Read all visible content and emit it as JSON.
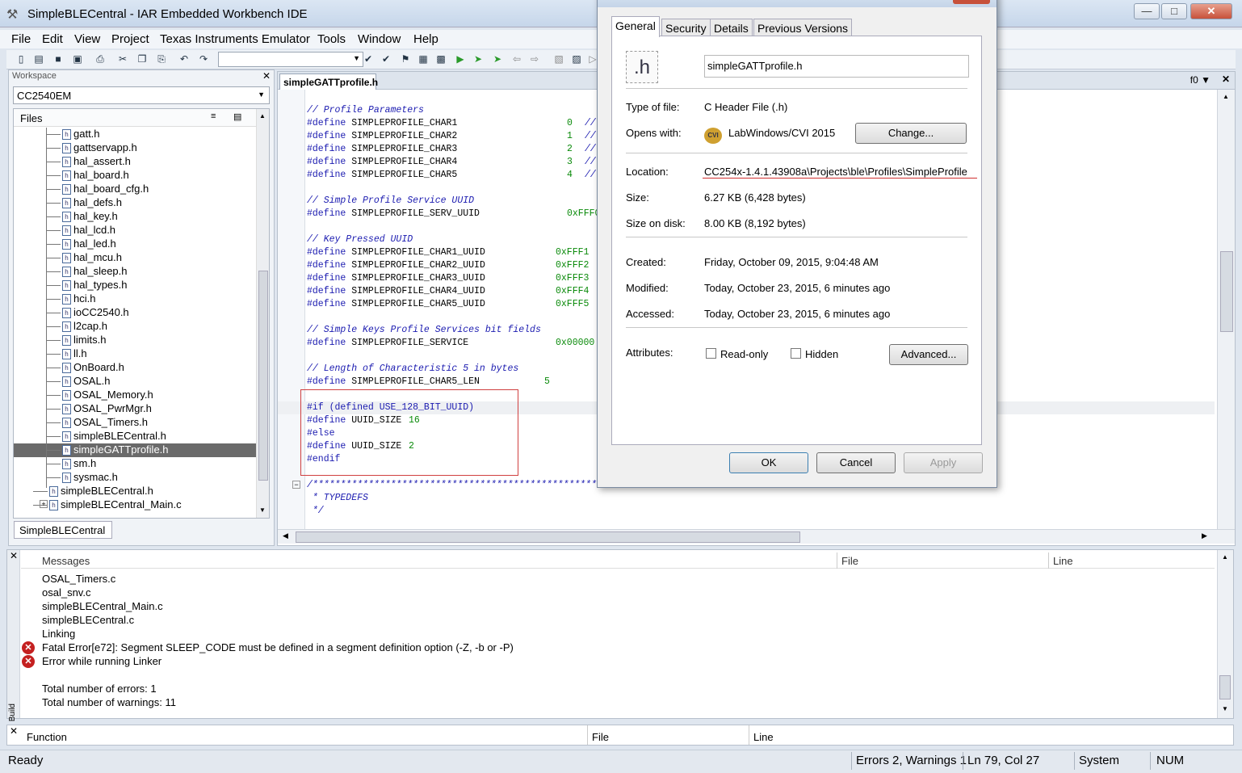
{
  "window": {
    "title": "SimpleBLECentral - IAR Embedded Workbench IDE",
    "min_label": "—",
    "max_label": "□",
    "close_label": "✕"
  },
  "menu": [
    "File",
    "Edit",
    "View",
    "Project",
    "Texas Instruments Emulator",
    "Tools",
    "Window",
    "Help"
  ],
  "workspace": {
    "title": "Workspace",
    "config": "CC2540EM",
    "files_label": "Files",
    "tab": "SimpleBLECentral",
    "files": [
      {
        "name": "gatt.h",
        "indent": 1
      },
      {
        "name": "gattservapp.h",
        "indent": 1
      },
      {
        "name": "hal_assert.h",
        "indent": 1
      },
      {
        "name": "hal_board.h",
        "indent": 1
      },
      {
        "name": "hal_board_cfg.h",
        "indent": 1
      },
      {
        "name": "hal_defs.h",
        "indent": 1
      },
      {
        "name": "hal_key.h",
        "indent": 1
      },
      {
        "name": "hal_lcd.h",
        "indent": 1
      },
      {
        "name": "hal_led.h",
        "indent": 1
      },
      {
        "name": "hal_mcu.h",
        "indent": 1
      },
      {
        "name": "hal_sleep.h",
        "indent": 1
      },
      {
        "name": "hal_types.h",
        "indent": 1
      },
      {
        "name": "hci.h",
        "indent": 1
      },
      {
        "name": "ioCC2540.h",
        "indent": 1
      },
      {
        "name": "l2cap.h",
        "indent": 1
      },
      {
        "name": "limits.h",
        "indent": 1
      },
      {
        "name": "ll.h",
        "indent": 1
      },
      {
        "name": "OnBoard.h",
        "indent": 1
      },
      {
        "name": "OSAL.h",
        "indent": 1
      },
      {
        "name": "OSAL_Memory.h",
        "indent": 1
      },
      {
        "name": "OSAL_PwrMgr.h",
        "indent": 1
      },
      {
        "name": "OSAL_Timers.h",
        "indent": 1
      },
      {
        "name": "simpleBLECentral.h",
        "indent": 1
      },
      {
        "name": "simpleGATTprofile.h",
        "indent": 1,
        "selected": true
      },
      {
        "name": "sm.h",
        "indent": 1
      },
      {
        "name": "sysmac.h",
        "indent": 1
      },
      {
        "name": "simpleBLECentral.h",
        "indent": 0
      },
      {
        "name": "simpleBLECentral_Main.c",
        "indent": 0,
        "expander": true
      }
    ]
  },
  "editor": {
    "tab": "simpleGATTprofile.h",
    "function": "f0",
    "lines": [
      {
        "kind": "comment",
        "text": "// Profile Parameters"
      },
      {
        "kind": "define",
        "text": "#define SIMPLEPROFILE_CHAR1",
        "value": "0",
        "tail": "//"
      },
      {
        "kind": "define",
        "text": "#define SIMPLEPROFILE_CHAR2",
        "value": "1",
        "tail": "//"
      },
      {
        "kind": "define",
        "text": "#define SIMPLEPROFILE_CHAR3",
        "value": "2",
        "tail": "//"
      },
      {
        "kind": "define",
        "text": "#define SIMPLEPROFILE_CHAR4",
        "value": "3",
        "tail": "//"
      },
      {
        "kind": "define",
        "text": "#define SIMPLEPROFILE_CHAR5",
        "value": "4",
        "tail": "//"
      },
      {
        "kind": "blank",
        "text": ""
      },
      {
        "kind": "comment",
        "text": "// Simple Profile Service UUID"
      },
      {
        "kind": "define",
        "text": "#define SIMPLEPROFILE_SERV_UUID",
        "value": "0xFFF0",
        "tail": ""
      },
      {
        "kind": "blank",
        "text": ""
      },
      {
        "kind": "comment",
        "text": "// Key Pressed UUID"
      },
      {
        "kind": "define",
        "text": "#define SIMPLEPROFILE_CHAR1_UUID",
        "value": "0xFFF1",
        "tail": ""
      },
      {
        "kind": "define",
        "text": "#define SIMPLEPROFILE_CHAR2_UUID",
        "value": "0xFFF2",
        "tail": ""
      },
      {
        "kind": "define",
        "text": "#define SIMPLEPROFILE_CHAR3_UUID",
        "value": "0xFFF3",
        "tail": ""
      },
      {
        "kind": "define",
        "text": "#define SIMPLEPROFILE_CHAR4_UUID",
        "value": "0xFFF4",
        "tail": ""
      },
      {
        "kind": "define",
        "text": "#define SIMPLEPROFILE_CHAR5_UUID",
        "value": "0xFFF5",
        "tail": ""
      },
      {
        "kind": "blank",
        "text": ""
      },
      {
        "kind": "comment",
        "text": "// Simple Keys Profile Services bit fields"
      },
      {
        "kind": "define",
        "text": "#define SIMPLEPROFILE_SERVICE",
        "value": "0x00000",
        "tail": ""
      },
      {
        "kind": "blank",
        "text": ""
      },
      {
        "kind": "comment",
        "text": "// Length of Characteristic 5 in bytes"
      },
      {
        "kind": "define",
        "text": "#define SIMPLEPROFILE_CHAR5_LEN",
        "value": "5",
        "tail": ""
      },
      {
        "kind": "blank",
        "text": ""
      },
      {
        "kind": "pp",
        "text": "#if (defined USE_128_BIT_UUID)",
        "value": "",
        "tail": ""
      },
      {
        "kind": "define",
        "text": "#define UUID_SIZE",
        "value": "16",
        "tail": ""
      },
      {
        "kind": "pp",
        "text": "#else",
        "value": "",
        "tail": ""
      },
      {
        "kind": "define",
        "text": "#define UUID_SIZE",
        "value": "2",
        "tail": ""
      },
      {
        "kind": "pp",
        "text": "#endif",
        "value": "",
        "tail": ""
      },
      {
        "kind": "blank",
        "text": ""
      },
      {
        "kind": "comment",
        "text": "/****************************************************************"
      },
      {
        "kind": "comment",
        "text": " * TYPEDEFS"
      },
      {
        "kind": "comment",
        "text": " */"
      }
    ]
  },
  "build": {
    "side_label": "Build",
    "columns": {
      "messages": "Messages",
      "file": "File",
      "line": "Line"
    },
    "messages": [
      {
        "text": "OSAL_Timers.c",
        "error": false
      },
      {
        "text": "osal_snv.c",
        "error": false
      },
      {
        "text": "simpleBLECentral_Main.c",
        "error": false
      },
      {
        "text": "simpleBLECentral.c",
        "error": false
      },
      {
        "text": "Linking",
        "error": false
      },
      {
        "text": "Fatal Error[e72]: Segment SLEEP_CODE must be defined in a segment definition option (-Z, -b or -P)",
        "error": true
      },
      {
        "text": "Error while running Linker",
        "error": true
      },
      {
        "text": "",
        "error": false
      },
      {
        "text": "Total number of errors: 1",
        "error": false
      },
      {
        "text": "Total number of warnings: 11",
        "error": false
      }
    ]
  },
  "function_pane": {
    "function": "Function",
    "file": "File",
    "line": "Line"
  },
  "status": {
    "ready": "Ready",
    "errors": "Errors 2, Warnings 1",
    "position": "Ln 79, Col 27",
    "system": "System",
    "num": "NUM"
  },
  "dialog": {
    "tabs": [
      "General",
      "Security",
      "Details",
      "Previous Versions"
    ],
    "file_icon": ".h",
    "file_name": "simpleGATTprofile.h",
    "type_label": "Type of file:",
    "type_value": "C Header File (.h)",
    "opens_label": "Opens with:",
    "opens_value": "LabWindows/CVI 2015",
    "app_icon_text": "CVI",
    "change_button": "Change...",
    "location_label": "Location:",
    "location_value": "CC254x-1.4.1.43908a\\Projects\\ble\\Profiles\\SimpleProfile",
    "size_label": "Size:",
    "size_value": "6.27 KB (6,428 bytes)",
    "size_disk_label": "Size on disk:",
    "size_disk_value": "8.00 KB (8,192 bytes)",
    "created_label": "Created:",
    "created_value": "Friday, October 09, 2015, 9:04:48 AM",
    "modified_label": "Modified:",
    "modified_value": "Today, October 23, 2015, 6 minutes ago",
    "accessed_label": "Accessed:",
    "accessed_value": "Today, October 23, 2015, 6 minutes ago",
    "attributes_label": "Attributes:",
    "readonly_label": "Read-only",
    "hidden_label": "Hidden",
    "advanced_button": "Advanced...",
    "ok_button": "OK",
    "cancel_button": "Cancel",
    "apply_button": "Apply"
  }
}
